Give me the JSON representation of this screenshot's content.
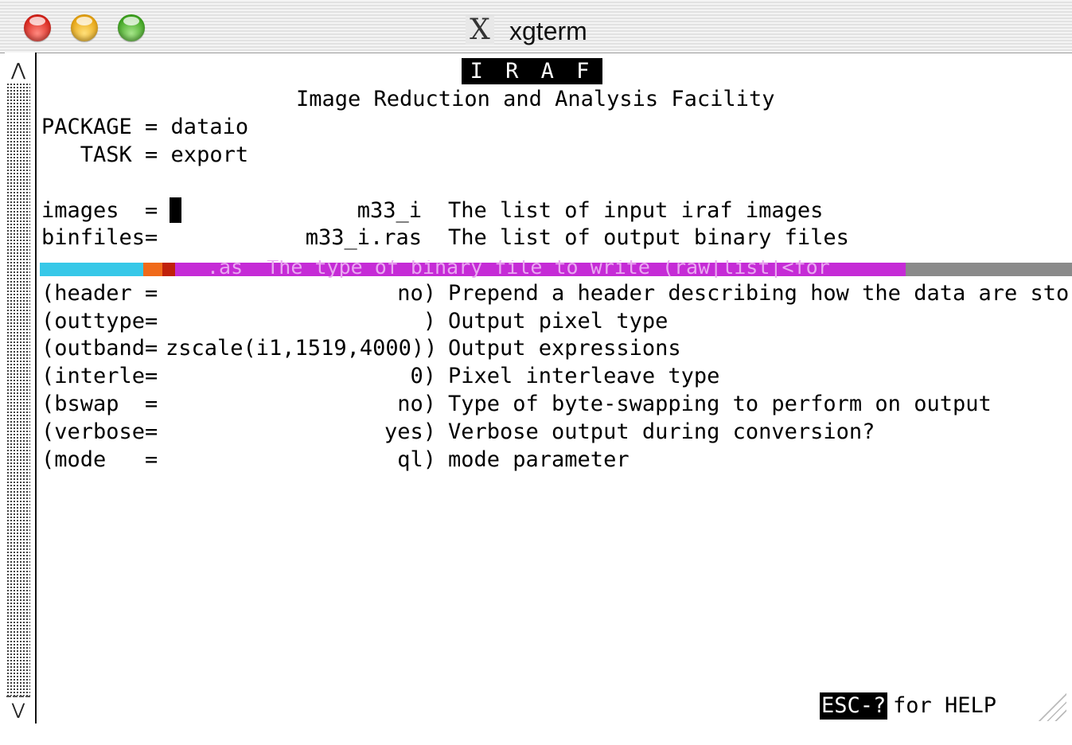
{
  "window": {
    "title": "xgterm",
    "x_logo": "X",
    "buttons": [
      "close",
      "minimize",
      "zoom"
    ]
  },
  "terminal": {
    "banner": "I R A F",
    "subtitle": "Image Reduction and Analysis Facility",
    "package_line": "PACKAGE = dataio",
    "task_line": "   TASK = export",
    "params": [
      {
        "name": "images  =",
        "value": "m33_i",
        "desc": "The list of input iraf images"
      },
      {
        "name": "binfiles=",
        "value": "m33_i.ras",
        "desc": "The list of output binary files"
      },
      {
        "name": "(header =",
        "value": "no)",
        "desc": "Prepend a header describing how the data are sto"
      },
      {
        "name": "(outtype=",
        "value": ")",
        "desc": "Output pixel type"
      },
      {
        "name": "(outband=",
        "value": "zscale(i1,1519,4000))",
        "desc": "Output expressions"
      },
      {
        "name": "(interle=",
        "value": "0)",
        "desc": "Pixel interleave type"
      },
      {
        "name": "(bswap  =",
        "value": "no)",
        "desc": "Type of byte-swapping to perform on output"
      },
      {
        "name": "(verbose=",
        "value": "yes)",
        "desc": "Verbose output during conversion?"
      },
      {
        "name": "(mode   =",
        "value": "ql)",
        "desc": "mode parameter"
      }
    ],
    "glitch_text": ".as  The type of binary file to write (raw|list|<for",
    "help_key": "ESC-?",
    "help_text": "for HELP"
  },
  "colors": {
    "glitch_cyan": "#36c8e8",
    "glitch_orange": "#f06a1a",
    "glitch_purple": "#c52bd6",
    "glitch_grey": "#8a8a8a"
  }
}
